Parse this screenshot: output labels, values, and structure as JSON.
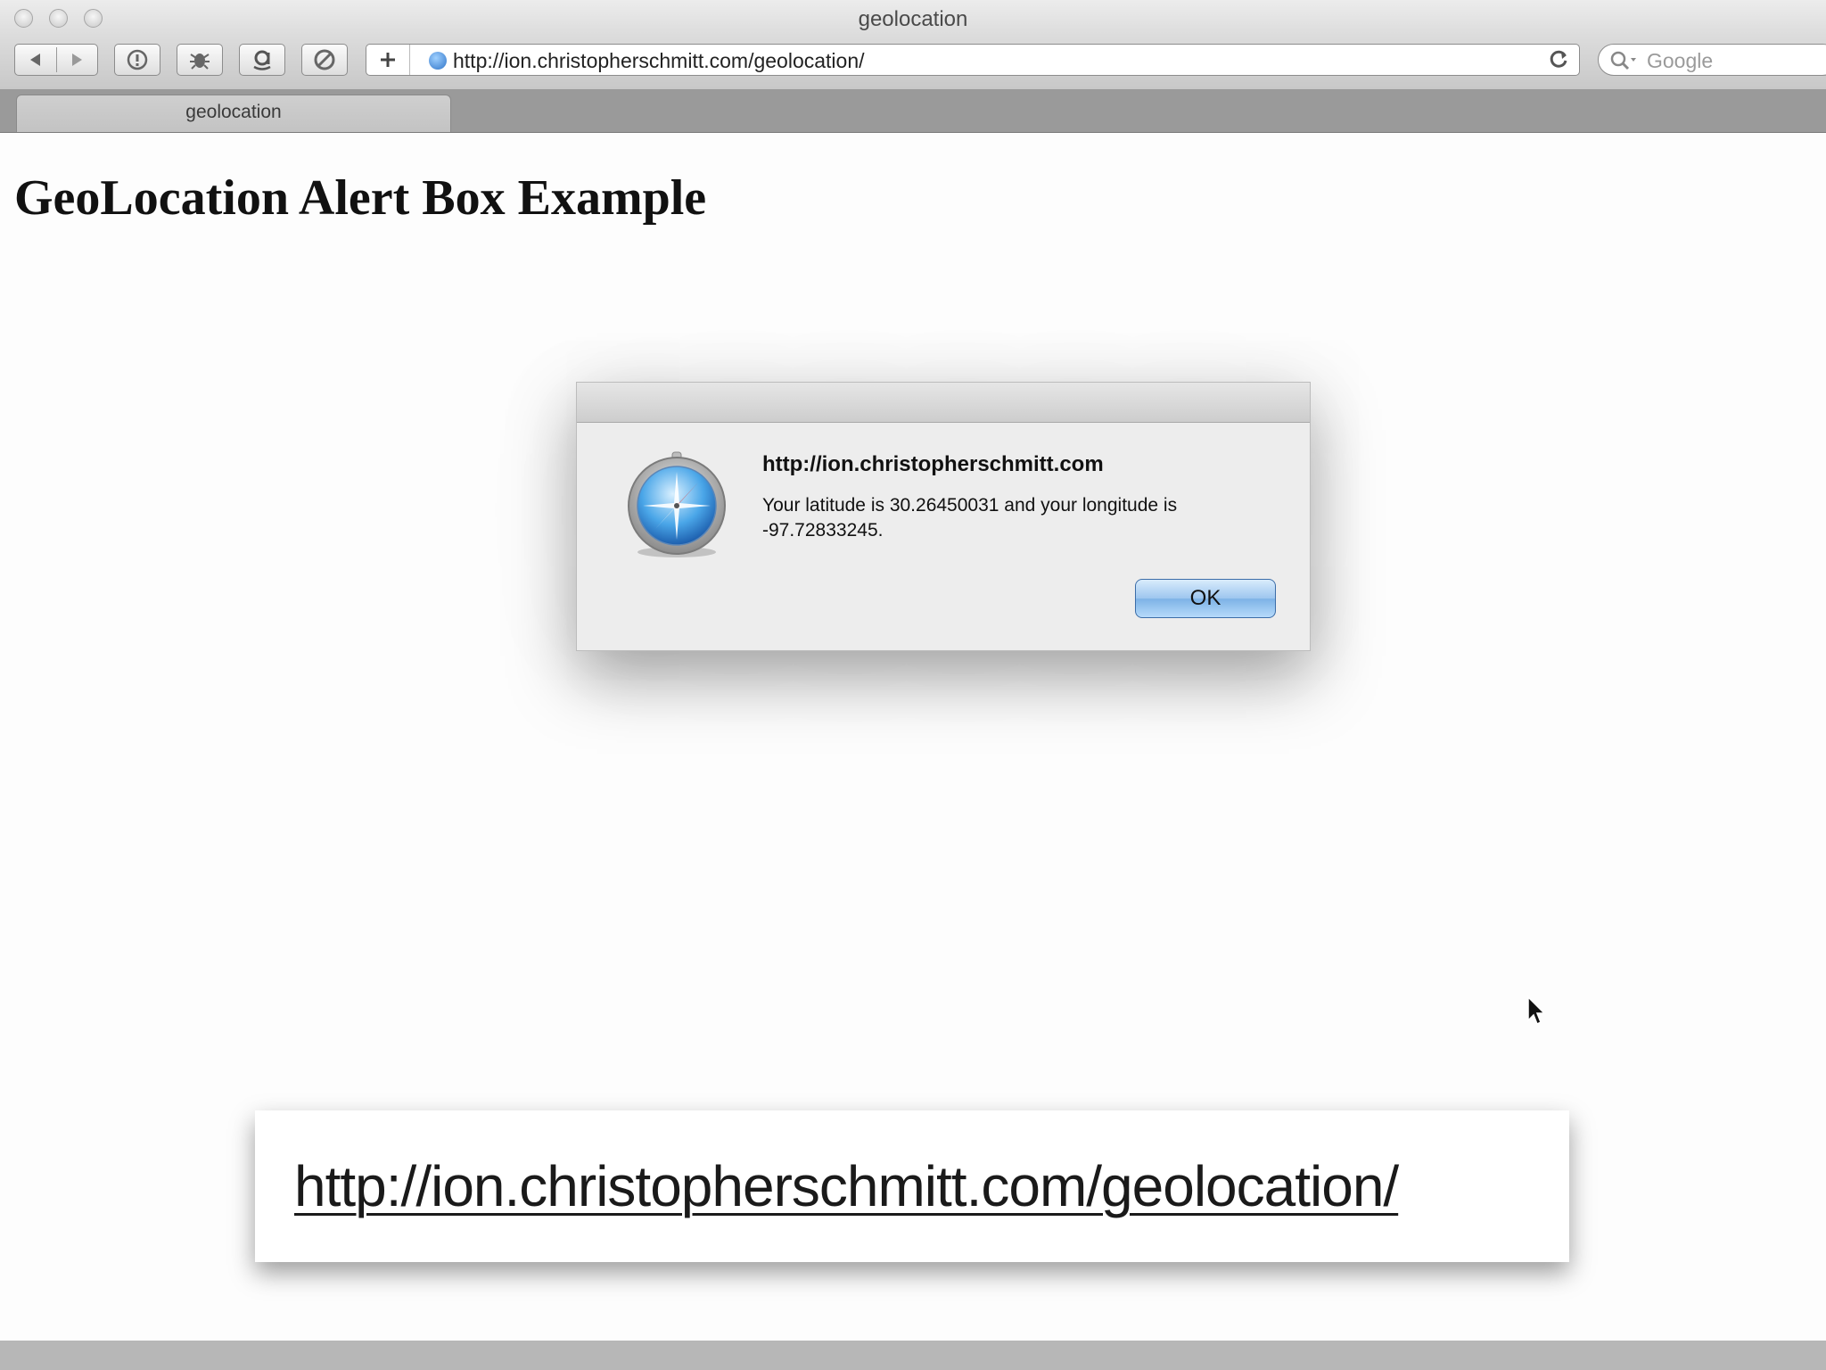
{
  "window": {
    "title": "geolocation"
  },
  "toolbar": {
    "address_url": "http://ion.christopherschmitt.com/geolocation/",
    "search_placeholder": "Google"
  },
  "tabs": [
    {
      "label": "geolocation"
    }
  ],
  "page": {
    "heading": "GeoLocation Alert Box Example"
  },
  "alert": {
    "title": "http://ion.christopherschmitt.com",
    "message": "Your latitude is 30.26450031 and your longitude is -97.72833245.",
    "ok_label": "OK"
  },
  "caption": {
    "url": "http://ion.christopherschmitt.com/geolocation/"
  },
  "colors": {
    "ok_button": "#9dc6ef",
    "toolbar": "#d4d4d4",
    "page_bg": "#fdfdfd"
  }
}
